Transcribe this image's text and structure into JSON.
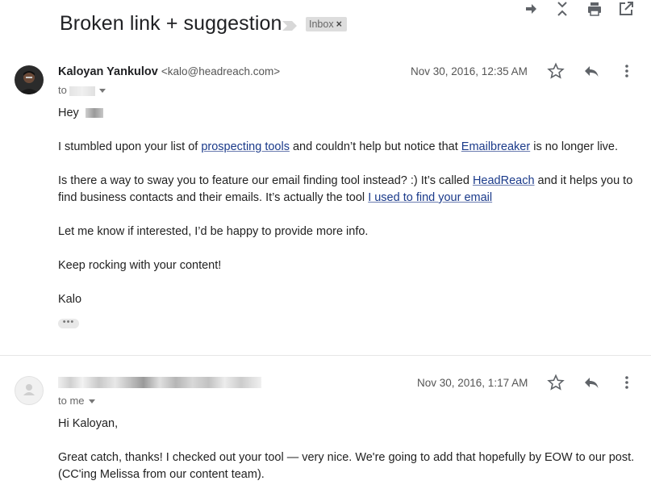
{
  "thread": {
    "subject": "Broken link + suggestion",
    "label": "Inbox",
    "label_remove": "×"
  },
  "toolbar": {
    "icons": [
      "forward-all-icon",
      "collapse-icon",
      "print-icon",
      "open-in-new-window-icon"
    ]
  },
  "messages": [
    {
      "sender_name": "Kaloyan Yankulov",
      "sender_email": "<kalo@headreach.com>",
      "to": "to",
      "recipient_redacted": true,
      "date": "Nov 30, 2016, 12:35 AM",
      "greeting": "Hey",
      "p1_a": "I stumbled upon your list of ",
      "p1_link1": "prospecting tools",
      "p1_b": " and couldn’t help but notice that ",
      "p1_link2": "Emailbreaker",
      "p1_c": " is no longer live.",
      "p2_a": "Is there a way to sway you to feature our email finding tool instead? :) It’s called ",
      "p2_link1": "HeadReach",
      "p2_b": " and it helps you to",
      "p2_c": "find business contacts and their emails. It’s actually the tool ",
      "p2_link2": "I used to find your email",
      "p3": "Let me know if interested, I’d be happy to provide more info.",
      "p4": "Keep rocking with your content!",
      "signoff": "Kalo",
      "expand": "•••"
    },
    {
      "sender_redacted": true,
      "to": "to me",
      "date": "Nov 30, 2016, 1:17 AM",
      "greeting": "Hi Kaloyan,",
      "p1": "Great catch, thanks! I checked out your tool — very nice. We're going to add that hopefully by EOW to our post.",
      "p2": "(CC'ing Melissa from our content team)."
    }
  ],
  "colors": {
    "link": "#1a3a8a",
    "label_chip_bg": "#dddddd",
    "icon": "#5f6368",
    "divider": "#e6e6e6"
  }
}
